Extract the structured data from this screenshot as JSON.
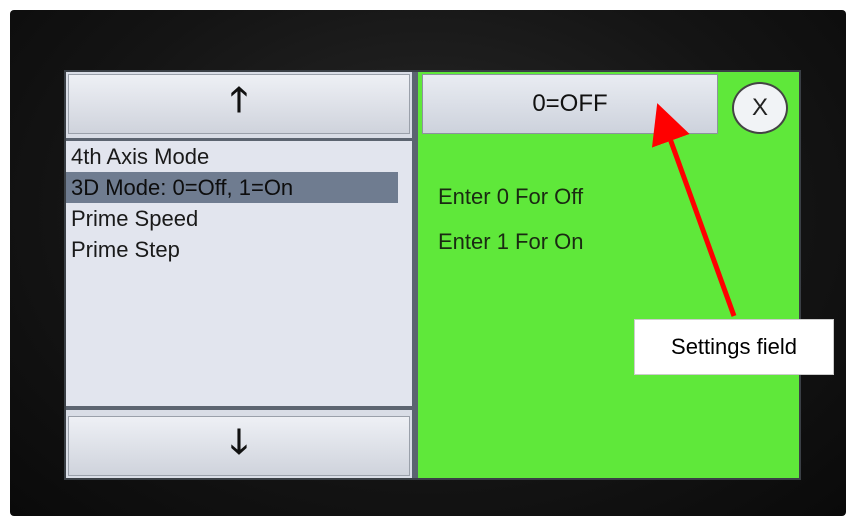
{
  "navigation": {
    "up_icon": "arrow-up-icon",
    "up_glyph": "🡑",
    "down_icon": "arrow-down-icon",
    "down_glyph": "🡓"
  },
  "menu": {
    "items": [
      {
        "label": "4th Axis Mode",
        "selected": false
      },
      {
        "label": "3D Mode: 0=Off, 1=On",
        "selected": true
      },
      {
        "label": "Prime Speed",
        "selected": false
      },
      {
        "label": "Prime Step",
        "selected": false
      }
    ]
  },
  "setting": {
    "value": "0=OFF",
    "close_label": "X",
    "help_lines": [
      "Enter 0 For Off",
      "Enter 1 For On"
    ]
  },
  "annotation": {
    "callout_text": "Settings field",
    "arrow_color": "#ff0000"
  },
  "colors": {
    "help_panel": "#5fe83a",
    "selected_row": "#6f7c90"
  }
}
